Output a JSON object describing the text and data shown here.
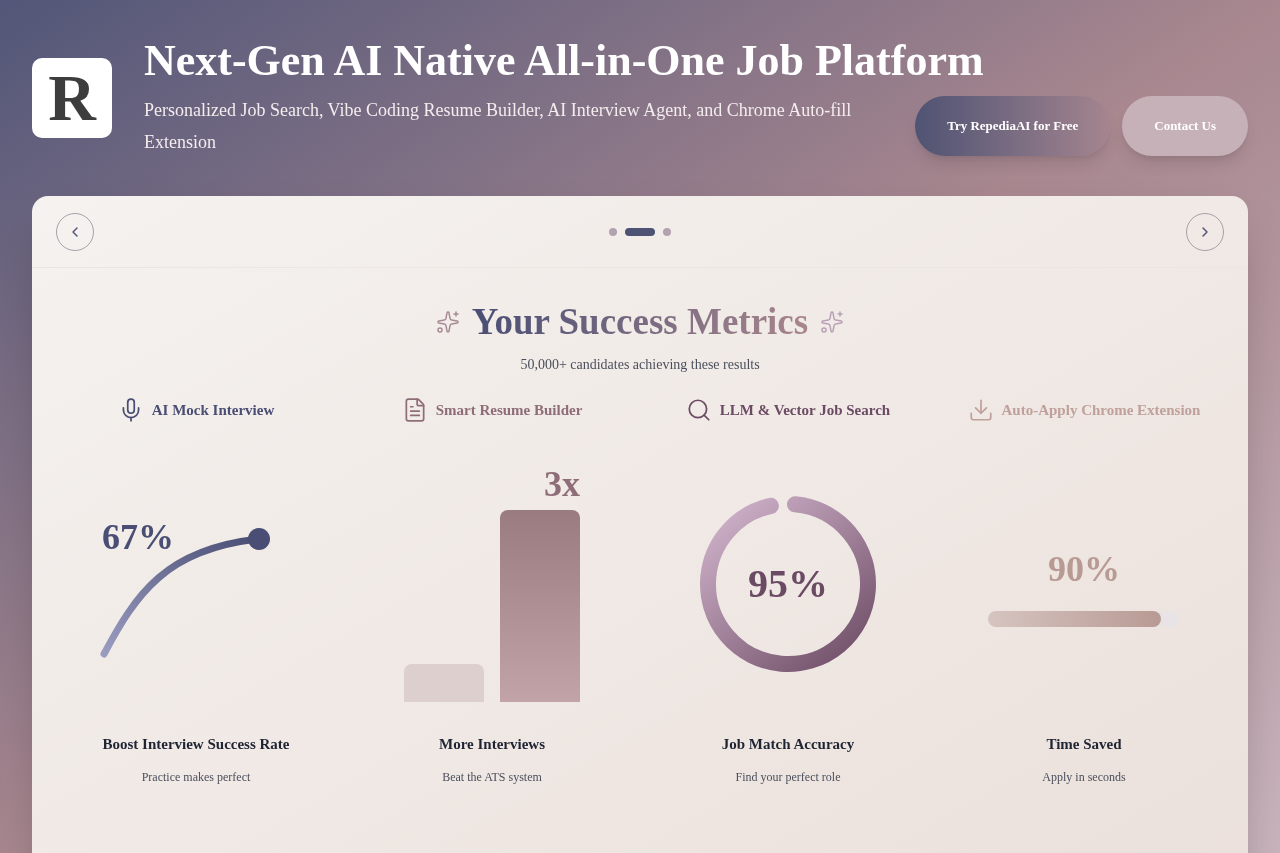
{
  "header": {
    "logo": "R",
    "title": "Next-Gen AI Native All-in-One Job Platform",
    "subtitle": "Personalized Job Search, Vibe Coding Resume Builder, AI Interview Agent, and Chrome Auto-fill Extension",
    "buttons": [
      {
        "label": "Try RepediaAI for Free",
        "kind": "primary"
      },
      {
        "label": "Contact Us",
        "kind": "secondary"
      }
    ]
  },
  "carousel": {
    "dots": [
      {
        "selected": false
      },
      {
        "selected": true
      },
      {
        "selected": false
      }
    ]
  },
  "section": {
    "title": "Your Success Metrics",
    "subtitle": "50,000+ candidates achieving these results"
  },
  "features": [
    {
      "label": "AI Mock Interview",
      "color": "#4a4e74"
    },
    {
      "label": "Smart Resume Builder",
      "color": "#8e6d78"
    },
    {
      "label": "LLM & Vector Job Search",
      "color": "#6b4a63"
    },
    {
      "label": "Auto-Apply Chrome Extension",
      "color": "#c0a09a"
    }
  ],
  "metrics": [
    {
      "kind": "curve",
      "value": "67%",
      "title": "Boost Interview Success Rate",
      "caption": "Practice makes perfect"
    },
    {
      "kind": "bars",
      "value": "3x",
      "title": "More Interviews",
      "caption": "Beat the ATS system"
    },
    {
      "kind": "ring",
      "value": "95%",
      "level": 0.95,
      "title": "Job Match Accuracy",
      "caption": "Find your perfect role"
    },
    {
      "kind": "progress",
      "value": "90%",
      "level": 0.9,
      "title": "Time Saved",
      "caption": "Apply in seconds"
    }
  ]
}
